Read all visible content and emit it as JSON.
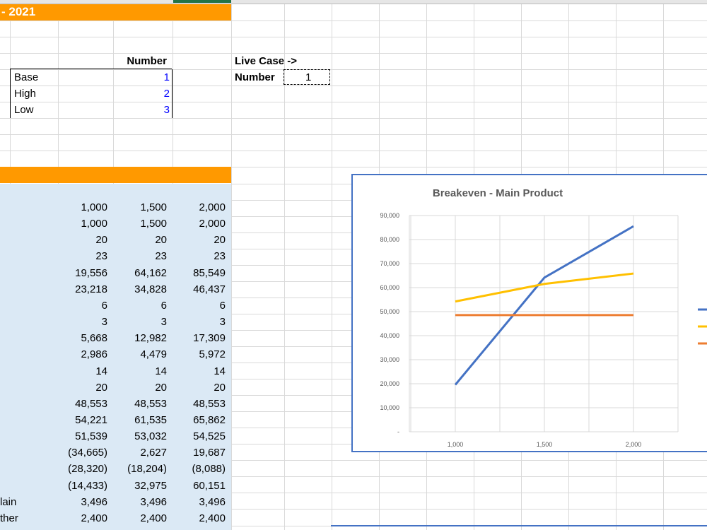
{
  "sheet": {
    "band_title": "- 2021",
    "scenario_table": {
      "header": "Number",
      "rows": [
        {
          "label": "Base",
          "value": "1"
        },
        {
          "label": "High",
          "value": "2"
        },
        {
          "label": "Low",
          "value": "3"
        }
      ]
    },
    "live_case": {
      "label": "Live Case ->",
      "number_label": "Number",
      "number_value": "1"
    },
    "data_rows": [
      {
        "label": "",
        "c1": "1,000",
        "c2": "1,500",
        "c3": "2,000"
      },
      {
        "label": "",
        "c1": "1,000",
        "c2": "1,500",
        "c3": "2,000"
      },
      {
        "label": "",
        "c1": "20",
        "c2": "20",
        "c3": "20"
      },
      {
        "label": "",
        "c1": "23",
        "c2": "23",
        "c3": "23"
      },
      {
        "label": "",
        "c1": "19,556",
        "c2": "64,162",
        "c3": "85,549"
      },
      {
        "label": "",
        "c1": "23,218",
        "c2": "34,828",
        "c3": "46,437"
      },
      {
        "label": "",
        "c1": "6",
        "c2": "6",
        "c3": "6"
      },
      {
        "label": "",
        "c1": "3",
        "c2": "3",
        "c3": "3"
      },
      {
        "label": "",
        "c1": "5,668",
        "c2": "12,982",
        "c3": "17,309"
      },
      {
        "label": "",
        "c1": "2,986",
        "c2": "4,479",
        "c3": "5,972"
      },
      {
        "label": "",
        "c1": "14",
        "c2": "14",
        "c3": "14"
      },
      {
        "label": "",
        "c1": "20",
        "c2": "20",
        "c3": "20"
      },
      {
        "label": "",
        "c1": "48,553",
        "c2": "48,553",
        "c3": "48,553"
      },
      {
        "label": "",
        "c1": "54,221",
        "c2": "61,535",
        "c3": "65,862"
      },
      {
        "label": "",
        "c1": "51,539",
        "c2": "53,032",
        "c3": "54,525"
      },
      {
        "label": "",
        "c1": "(34,665)",
        "c2": "2,627",
        "c3": "19,687"
      },
      {
        "label": "",
        "c1": "(28,320)",
        "c2": "(18,204)",
        "c3": "(8,088)"
      },
      {
        "label": "",
        "c1": "(14,433)",
        "c2": "32,975",
        "c3": "60,151"
      },
      {
        "label": "lain",
        "c1": "3,496",
        "c2": "3,496",
        "c3": "3,496"
      },
      {
        "label": "ther",
        "c1": "2,400",
        "c2": "2,400",
        "c3": "2,400"
      }
    ]
  },
  "colors": {
    "band": "#ff9900",
    "input_region": "#dbe9f5",
    "grid": "#d9d9d9",
    "chart_border": "#4472c4"
  },
  "chart_data": {
    "type": "line",
    "title": "Breakeven - Main Product",
    "categories": [
      "1,000",
      "1,500",
      "2,000"
    ],
    "x": [
      1000,
      1500,
      2000
    ],
    "ylim": [
      0,
      90000
    ],
    "yticks": [
      "-",
      "10,000",
      "20,000",
      "30,000",
      "40,000",
      "50,000",
      "60,000",
      "70,000",
      "80,000",
      "90,000"
    ],
    "grid": true,
    "legend": "right (partially cut off, labels not visible)",
    "series": [
      {
        "color": "#4472c4",
        "values": [
          19556,
          64162,
          85549
        ]
      },
      {
        "color": "#ffc000",
        "values": [
          54221,
          61535,
          65862
        ]
      },
      {
        "color": "#ed7d31",
        "values": [
          48553,
          48553,
          48553
        ]
      }
    ]
  }
}
